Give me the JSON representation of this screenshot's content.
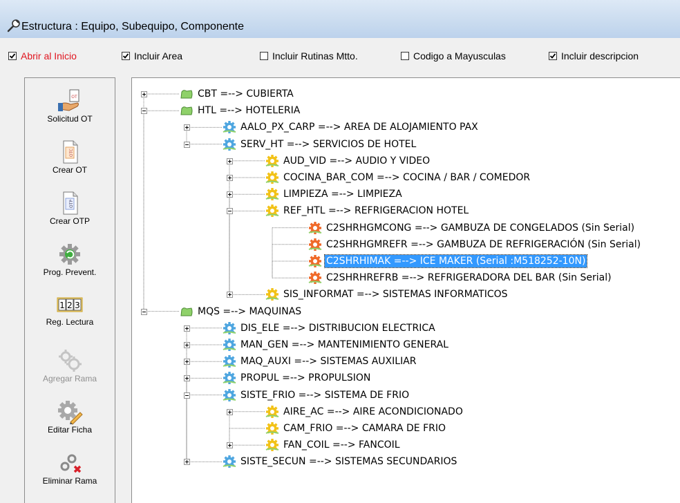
{
  "window": {
    "title": "Estructura : Equipo, Subequipo, Componente"
  },
  "options": [
    {
      "label": "Abrir al Inicio",
      "checked": true,
      "color": "#e0141e"
    },
    {
      "label": "Incluir Area",
      "checked": true
    },
    {
      "label": "Incluir Rutinas Mtto.",
      "checked": false
    },
    {
      "label": "Codigo a Mayusculas",
      "checked": false
    },
    {
      "label": "Incluir descripcion",
      "checked": true
    }
  ],
  "toolbar": [
    {
      "label": "Solicitud OT",
      "icon": "hand-ot-icon",
      "enabled": true
    },
    {
      "label": "Crear OT",
      "icon": "document-ot-icon",
      "enabled": true
    },
    {
      "label": "Crear OTP",
      "icon": "document-otp-icon",
      "enabled": true
    },
    {
      "label": "Prog. Prevent.",
      "icon": "gear-cycle-icon",
      "enabled": true
    },
    {
      "label": "Reg. Lectura",
      "icon": "counter-123-icon",
      "icon_text": [
        "1",
        "2",
        "3"
      ],
      "enabled": true
    },
    {
      "label": "Agregar Rama",
      "icon": "add-branch-gears-icon",
      "enabled": false
    },
    {
      "label": "Editar Ficha",
      "icon": "edit-gear-icon",
      "enabled": true
    },
    {
      "label": "Eliminar Rama",
      "icon": "delete-branch-icon",
      "enabled": true
    }
  ],
  "tree": [
    {
      "text": "CBT =--> CUBIERTA",
      "level": 0,
      "icon": "area-icon",
      "expander": "plus"
    },
    {
      "text": "HTL =--> HOTELERIA",
      "level": 0,
      "icon": "area-icon",
      "expander": "minus"
    },
    {
      "text": "AALO_PX_CARP =--> AREA DE ALOJAMIENTO PAX",
      "level": 1,
      "icon": "equipment-gear-icon",
      "expander": "plus"
    },
    {
      "text": "SERV_HT =--> SERVICIOS DE HOTEL",
      "level": 1,
      "icon": "equipment-gear-icon",
      "expander": "minus"
    },
    {
      "text": "AUD_VID =--> AUDIO Y VIDEO",
      "level": 2,
      "icon": "subequipment-gear-icon",
      "expander": "plus"
    },
    {
      "text": "COCINA_BAR_COM =--> COCINA / BAR / COMEDOR",
      "level": 2,
      "icon": "subequipment-gear-icon",
      "expander": "plus"
    },
    {
      "text": "LIMPIEZA =--> LIMPIEZA",
      "level": 2,
      "icon": "subequipment-gear-icon",
      "expander": "plus"
    },
    {
      "text": "REF_HTL =--> REFRIGERACION HOTEL",
      "level": 2,
      "icon": "subequipment-gear-icon",
      "expander": "minus"
    },
    {
      "text": "C2SHRHGMCONG =--> GAMBUZA DE CONGELADOS (Sin Serial)",
      "level": 3,
      "icon": "component-gear-icon",
      "expander": "none"
    },
    {
      "text": "C2SHRHGMREFR =--> GAMBUZA DE REFRIGERACIÓN (Sin Serial)",
      "level": 3,
      "icon": "component-gear-icon",
      "expander": "none"
    },
    {
      "text": "C2SHRHIMAK =--> ICE MAKER (Serial :M518252-10N)",
      "level": 3,
      "icon": "component-gear-icon",
      "expander": "none",
      "selected": true
    },
    {
      "text": "C2SHRHREFRB =--> REFRIGERADORA DEL BAR (Sin Serial)",
      "level": 3,
      "icon": "component-gear-icon",
      "expander": "none"
    },
    {
      "text": "SIS_INFORMAT =--> SISTEMAS INFORMATICOS",
      "level": 2,
      "icon": "subequipment-gear-icon",
      "expander": "plus"
    },
    {
      "text": "MQS =--> MAQUINAS",
      "level": 0,
      "icon": "area-icon",
      "expander": "minus"
    },
    {
      "text": "DIS_ELE =--> DISTRIBUCION ELECTRICA",
      "level": 1,
      "icon": "equipment-gear-icon",
      "expander": "plus"
    },
    {
      "text": "MAN_GEN =--> MANTENIMIENTO GENERAL",
      "level": 1,
      "icon": "equipment-gear-icon",
      "expander": "plus"
    },
    {
      "text": "MAQ_AUXI =--> SISTEMAS  AUXILIAR",
      "level": 1,
      "icon": "equipment-gear-icon",
      "expander": "plus"
    },
    {
      "text": "PROPUL =--> PROPULSION",
      "level": 1,
      "icon": "equipment-gear-icon",
      "expander": "plus"
    },
    {
      "text": "SISTE_FRIO =--> SISTEMA DE FRIO",
      "level": 1,
      "icon": "equipment-gear-icon",
      "expander": "minus"
    },
    {
      "text": "AIRE_AC =--> AIRE ACONDICIONADO",
      "level": 2,
      "icon": "subequipment-gear-icon",
      "expander": "plus"
    },
    {
      "text": "CAM_FRIO =--> CAMARA DE FRIO",
      "level": 2,
      "icon": "subequipment-gear-icon",
      "expander": "none"
    },
    {
      "text": "FAN_COIL =--> FANCOIL",
      "level": 2,
      "icon": "subequipment-gear-icon",
      "expander": "plus"
    },
    {
      "text": "SISTE_SECUN =--> SISTEMAS SECUNDARIOS",
      "level": 1,
      "icon": "equipment-gear-icon",
      "expander": "plus"
    }
  ],
  "colors": {
    "selection": "#3399ff",
    "area_icon": "#8fd16a",
    "equipment_gear": "#4ea6e0",
    "subequipment_gear": "#f2c218",
    "component_gear": "#f06a2a"
  }
}
